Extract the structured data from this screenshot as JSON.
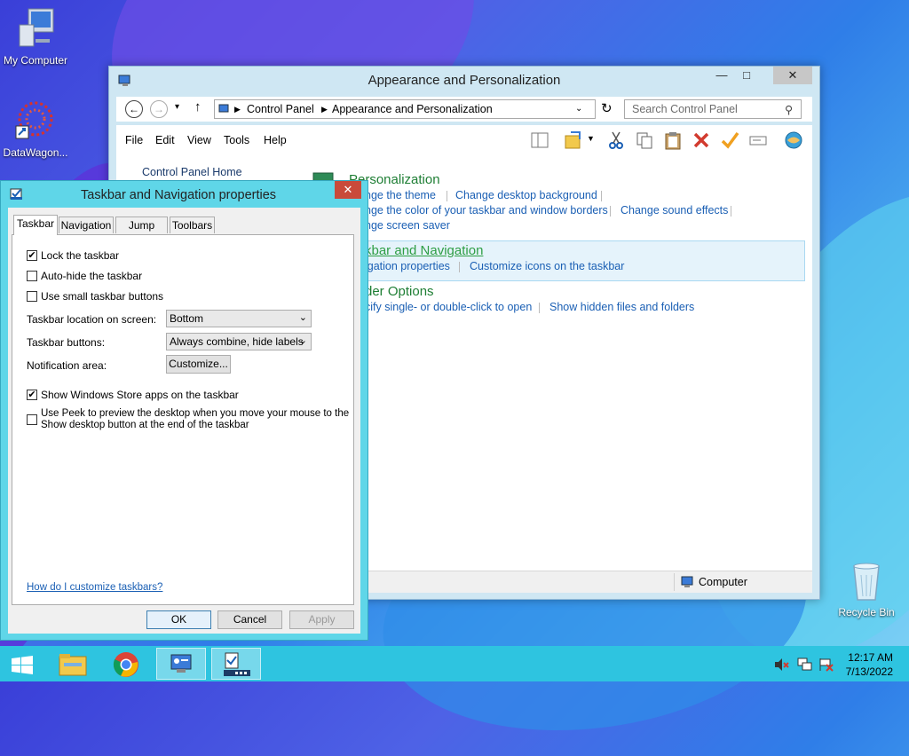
{
  "desktop": {
    "icons": [
      {
        "label": "My Computer"
      },
      {
        "label": "DataWagon..."
      },
      {
        "label": "Recycle Bin"
      }
    ]
  },
  "control_panel": {
    "title": "Appearance and Personalization",
    "breadcrumb": [
      "Control Panel",
      "Appearance and Personalization"
    ],
    "search_placeholder": "Search Control Panel",
    "menu": [
      "File",
      "Edit",
      "View",
      "Tools",
      "Help"
    ],
    "sidebar_home": "Control Panel Home",
    "sections": [
      {
        "heading": "Personalization",
        "links": [
          "nge the theme",
          "Change desktop background",
          "nge the color of your taskbar and window borders",
          "Change sound effects",
          "nge screen saver"
        ]
      },
      {
        "heading": "kbar and Navigation",
        "links": [
          "igation properties",
          "Customize icons on the taskbar"
        ]
      },
      {
        "heading": "der Options",
        "links": [
          "cify single- or double-click to open",
          "Show hidden files and folders"
        ]
      }
    ],
    "status_text": "Computer"
  },
  "dialog": {
    "title": "Taskbar and Navigation properties",
    "tabs": [
      "Taskbar",
      "Navigation",
      "Jump Lists",
      "Toolbars"
    ],
    "active_tab": "Taskbar",
    "options": {
      "lock_taskbar": {
        "label": "Lock the taskbar",
        "checked": true
      },
      "auto_hide": {
        "label": "Auto-hide the taskbar",
        "checked": false
      },
      "small_buttons": {
        "label": "Use small taskbar buttons",
        "checked": false
      },
      "store_apps": {
        "label": "Show Windows Store apps on the taskbar",
        "checked": true
      },
      "peek": {
        "label_line1": "Use Peek to preview the desktop when you move your mouse to the",
        "label_line2": "Show desktop button at the end of the taskbar",
        "checked": false
      }
    },
    "location_label": "Taskbar location on screen:",
    "location_value": "Bottom",
    "buttons_label": "Taskbar buttons:",
    "buttons_value": "Always combine, hide labels",
    "notification_label": "Notification area:",
    "customize_button": "Customize...",
    "help_link": "How do I customize taskbars?",
    "ok": "OK",
    "cancel": "Cancel",
    "apply": "Apply"
  },
  "taskbar": {
    "time": "12:17 AM",
    "date": "7/13/2022"
  }
}
